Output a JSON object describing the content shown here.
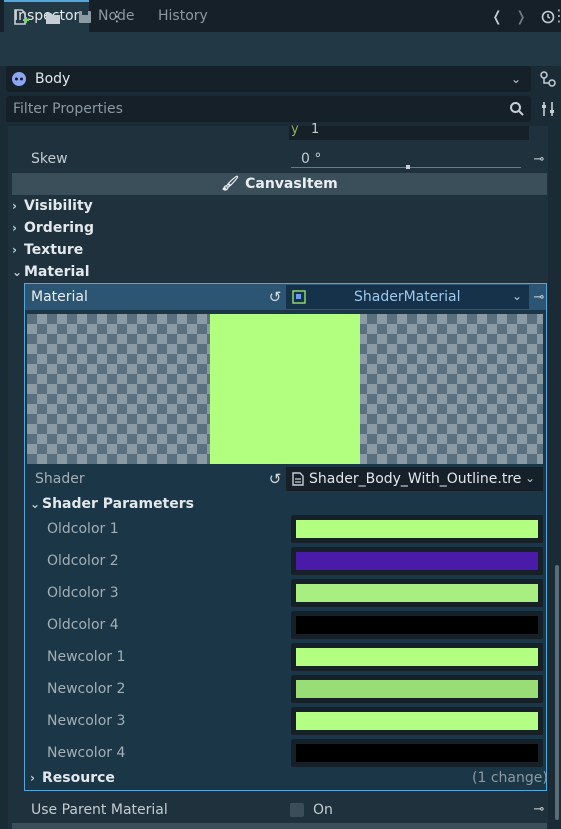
{
  "tabs": [
    {
      "label": "Inspector",
      "active": true
    },
    {
      "label": "Node",
      "active": false
    },
    {
      "label": "History",
      "active": false
    }
  ],
  "toolbar": {
    "icons": [
      "new-resource-icon",
      "open-folder-icon",
      "save-icon",
      "more-icon",
      "back-icon",
      "forward-icon",
      "history-icon"
    ]
  },
  "object": {
    "name": "Body"
  },
  "filter": {
    "placeholder": "Filter Properties"
  },
  "skew": {
    "label": "Skew",
    "value": "0 °",
    "prev_axis": "y",
    "prev_value": "1"
  },
  "canvasitem": {
    "title": "CanvasItem"
  },
  "sections": {
    "visibility": "Visibility",
    "ordering": "Ordering",
    "texture": "Texture",
    "material": "Material"
  },
  "material": {
    "label": "Material",
    "value": "ShaderMaterial",
    "preview_color": "#b2ff80",
    "shader_label": "Shader",
    "shader_value": "Shader_Body_With_Outline.tre",
    "shader_params_title": "Shader Parameters",
    "params": [
      {
        "label": "Oldcolor 1",
        "color": "#b3ff82"
      },
      {
        "label": "Oldcolor 2",
        "color": "#4a1ba8"
      },
      {
        "label": "Oldcolor 3",
        "color": "#a9ee80"
      },
      {
        "label": "Oldcolor 4",
        "color": "#000000"
      },
      {
        "label": "Newcolor 1",
        "color": "#b3ff82"
      },
      {
        "label": "Newcolor 2",
        "color": "#99dd77"
      },
      {
        "label": "Newcolor 3",
        "color": "#b3ff85"
      },
      {
        "label": "Newcolor 4",
        "color": "#000000"
      }
    ],
    "resource_label": "Resource",
    "resource_changes": "(1 change)"
  },
  "use_parent_material": {
    "label": "Use Parent Material",
    "value": "On",
    "checked": false
  },
  "colors": {
    "accent": "#56a6d9",
    "panel_bg": "#1f313c",
    "material_header_bg": "#2b5573"
  }
}
